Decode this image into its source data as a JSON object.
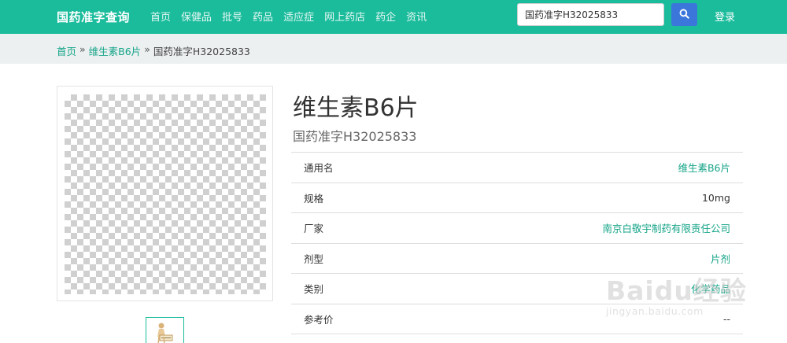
{
  "navbar": {
    "brand": "国药准字查询",
    "links": [
      "首页",
      "保健品",
      "批号",
      "药品",
      "适应症",
      "网上药店",
      "药企",
      "资讯"
    ],
    "search_value": "国药准字H32025833",
    "login": "登录",
    "accent_color": "#1abc9c",
    "search_button_color": "#3b77db"
  },
  "breadcrumb": {
    "home": "首页",
    "separator": "»",
    "parent": "维生素B6片",
    "current": "国药准字H32025833"
  },
  "product": {
    "title": "维生素B6片",
    "subtitle": "国药准字H32025833"
  },
  "table": {
    "rows": [
      {
        "label": "通用名",
        "value": "维生素B6片"
      },
      {
        "label": "规格",
        "value": "10mg"
      },
      {
        "label": "厂家",
        "value": "南京白敬宇制药有限责任公司"
      },
      {
        "label": "剂型",
        "value": "片剂"
      },
      {
        "label": "类别",
        "value": "化学药品"
      },
      {
        "label": "参考价",
        "value": "--"
      }
    ]
  },
  "icons": {
    "search": "search-icon",
    "thumbnail": "product-thumbnail-icon"
  },
  "watermark": {
    "logo": "Baidu经验",
    "url": "jingyan.baidu.com"
  }
}
